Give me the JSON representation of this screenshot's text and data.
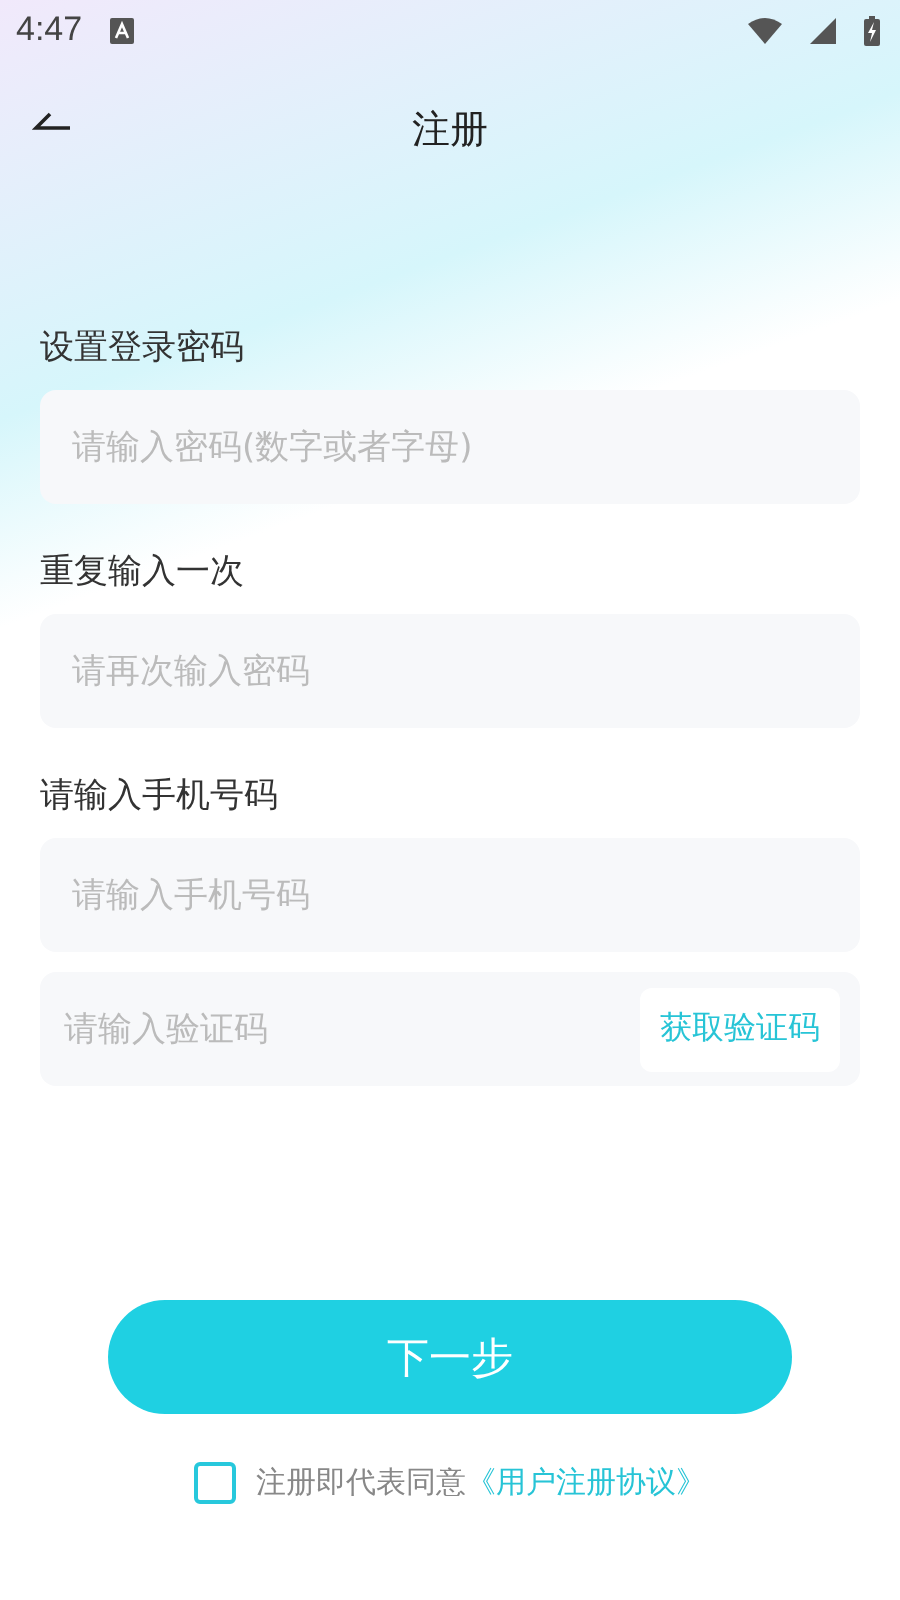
{
  "status_bar": {
    "time": "4:47"
  },
  "header": {
    "title": "注册"
  },
  "sections": [
    {
      "label": "设置登录密码",
      "fields": [
        {
          "kind": "text",
          "placeholder": "请输入密码(数字或者字母)"
        }
      ]
    },
    {
      "label": "重复输入一次",
      "fields": [
        {
          "kind": "text",
          "placeholder": "请再次输入密码"
        }
      ]
    },
    {
      "label": "请输入手机号码",
      "fields": [
        {
          "kind": "text",
          "placeholder": "请输入手机号码"
        },
        {
          "kind": "code",
          "placeholder": "请输入验证码",
          "button": "获取验证码"
        }
      ]
    }
  ],
  "next_button": "下一步",
  "agreement": {
    "checked": false,
    "text": "注册即代表同意",
    "link": "《用户注册协议》"
  }
}
